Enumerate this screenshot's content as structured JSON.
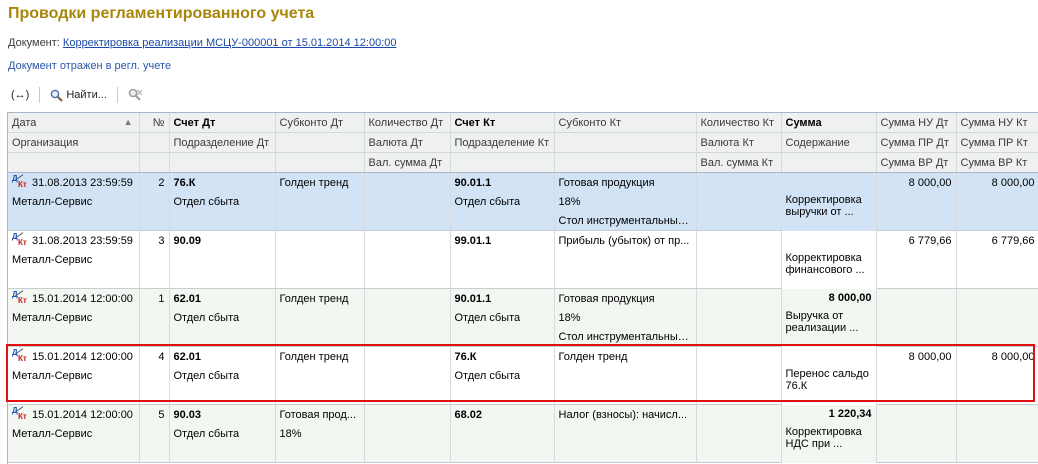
{
  "page": {
    "title": "Проводки регламентированного учета",
    "document_label": "Документ:",
    "document_link": "Корректировка реализации МСЦУ-000001 от 15.01.2014 12:00:00",
    "reflected_text": "Документ отражен в регл. учете"
  },
  "toolbar": {
    "toggle_label": "(↔)",
    "find_label": "Найти...",
    "search_icon": "magnifier-icon",
    "cancel_search_icon": "cancel-search-icon"
  },
  "table": {
    "header1": [
      "Дата",
      "№",
      "Счет Дт",
      "Субконто Дт",
      "Количество Дт",
      "Счет Кт",
      "Субконто Кт",
      "Количество Кт",
      "Сумма",
      "Сумма НУ Дт",
      "Сумма НУ Кт"
    ],
    "header2": [
      "Организация",
      "",
      "Подразделение Дт",
      "",
      "Валюта Дт",
      "Подразделение Кт",
      "",
      "Валюта Кт",
      "Содержание",
      "Сумма ПР Дт",
      "Сумма ПР Кт"
    ],
    "header3": [
      "",
      "",
      "",
      "",
      "Вал. сумма Дт",
      "",
      "",
      "Вал. сумма Кт",
      "",
      "Сумма ВР Дт",
      "Сумма ВР Кт"
    ],
    "records": [
      {
        "date": "31.08.2013 23:59:59",
        "num": "2",
        "account_dt": "76.К",
        "subconto_dt1": "Голден тренд",
        "account_kt": "90.01.1",
        "subconto_kt1": "Готовая продукция",
        "sum": "",
        "sum_nu_dt": "8 000,00",
        "sum_nu_kt": "8 000,00",
        "org": "Металл-Сервис",
        "dept_dt": "Отдел сбыта",
        "subconto_dt2": "",
        "dept_kt": "Отдел сбыта",
        "subconto_kt2": "18%",
        "content": "Корректировка выручки от ...",
        "subconto_kt3": "Стол инструментальный..."
      },
      {
        "date": "31.08.2013 23:59:59",
        "num": "3",
        "account_dt": "90.09",
        "subconto_dt1": "",
        "account_kt": "99.01.1",
        "subconto_kt1": "Прибыль (убыток) от пр...",
        "sum": "",
        "sum_nu_dt": "6 779,66",
        "sum_nu_kt": "6 779,66",
        "org": "Металл-Сервис",
        "dept_dt": "",
        "subconto_dt2": "",
        "dept_kt": "",
        "subconto_kt2": "",
        "content": "Корректировка финансового ...",
        "subconto_kt3": ""
      },
      {
        "date": "15.01.2014 12:00:00",
        "num": "1",
        "account_dt": "62.01",
        "subconto_dt1": "Голден тренд",
        "account_kt": "90.01.1",
        "subconto_kt1": "Готовая продукция",
        "sum": "8 000,00",
        "sum_nu_dt": "",
        "sum_nu_kt": "",
        "org": "Металл-Сервис",
        "dept_dt": "Отдел сбыта",
        "subconto_dt2": "",
        "dept_kt": "Отдел сбыта",
        "subconto_kt2": "18%",
        "content": "Выручка от реализации ...",
        "subconto_kt3": "Стол инструментальный..."
      },
      {
        "date": "15.01.2014 12:00:00",
        "num": "4",
        "account_dt": "62.01",
        "subconto_dt1": "Голден тренд",
        "account_kt": "76.К",
        "subconto_kt1": "Голден тренд",
        "sum": "",
        "sum_nu_dt": "8 000,00",
        "sum_nu_kt": "8 000,00",
        "org": "Металл-Сервис",
        "dept_dt": "Отдел сбыта",
        "subconto_dt2": "",
        "dept_kt": "Отдел сбыта",
        "subconto_kt2": "",
        "content": "Перенос сальдо 76.К",
        "subconto_kt3": ""
      },
      {
        "date": "15.01.2014 12:00:00",
        "num": "5",
        "account_dt": "90.03",
        "subconto_dt1": "Готовая прод...",
        "account_kt": "68.02",
        "subconto_kt1": "Налог (взносы): начисл...",
        "sum": "1 220,34",
        "sum_nu_dt": "",
        "sum_nu_kt": "",
        "org": "Металл-Сервис",
        "dept_dt": "Отдел сбыта",
        "subconto_dt2": "18%",
        "dept_kt": "",
        "subconto_kt2": "",
        "content": "Корректировка НДС при ...",
        "subconto_kt3": ""
      }
    ]
  },
  "colors": {
    "title": "#a8860a",
    "link": "#1a4ba8",
    "selected_row": "#d2e3f5",
    "alt_row": "#f3f7f2",
    "highlight_border": "#e01010"
  }
}
